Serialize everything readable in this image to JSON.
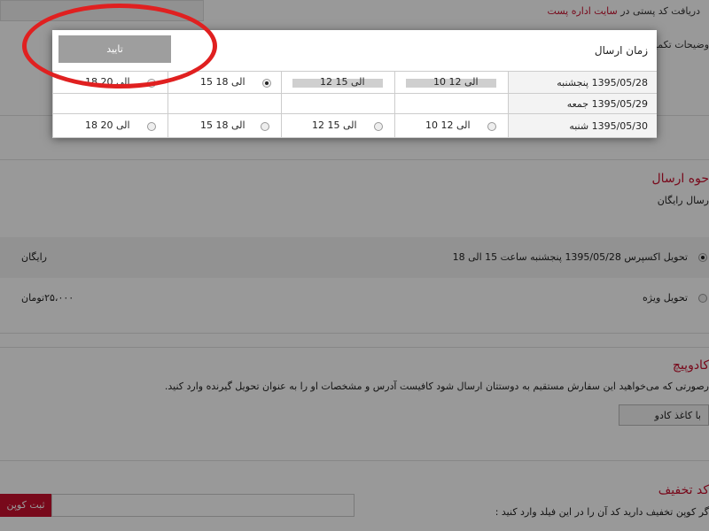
{
  "background": {
    "postal_code_text": "دریافت کد پستی در",
    "postal_link_text": "سایت اداره پست",
    "more_info_label": "وضیحات تکمیل",
    "shipping_method_title": "حوه ارسال",
    "free_shipping_label": "رسال رایگان",
    "express_label": "تحویل اکسپرس 1395/05/28 پنجشنبه ساعت 15 الی 18",
    "express_price": "رایگان",
    "special_label": "تحویل ویژه",
    "special_price": "۲۵،۰۰۰تومان",
    "gift_title": "کادوپیچ",
    "gift_text": "رصورتی که می‌خواهید این سفارش مستقیم به دوستتان ارسال شود کافیست آدرس و مشخصات او را به عنوان تحویل گیرنده وارد کنید.",
    "gift_button": "با کاغذ کادو",
    "discount_title": "کد تخفیف",
    "discount_text": "گر کوپن تخفیف دارید کد آن را در این فیلد وارد کنید :",
    "coupon_button": "ثبت کوپن"
  },
  "modal": {
    "title": "زمان ارسال",
    "confirm_label": "تایید",
    "days": [
      {
        "label": "1395/05/28 پنجشنبه",
        "slots": [
          {
            "label": "10 الی 12",
            "state": "unavailable"
          },
          {
            "label": "12 الی 15",
            "state": "unavailable"
          },
          {
            "label": "15 الی 18",
            "state": "selected"
          },
          {
            "label": "18 الی 20",
            "state": "available"
          }
        ]
      },
      {
        "label": "1395/05/29 جمعه",
        "slots": []
      },
      {
        "label": "1395/05/30 شنبه",
        "slots": [
          {
            "label": "10 الی 12",
            "state": "available"
          },
          {
            "label": "12 الی 15",
            "state": "available"
          },
          {
            "label": "15 الی 18",
            "state": "available"
          },
          {
            "label": "18 الی 20",
            "state": "available"
          }
        ]
      }
    ]
  },
  "colors": {
    "accent": "#c8102e",
    "annotation": "#e02020"
  }
}
